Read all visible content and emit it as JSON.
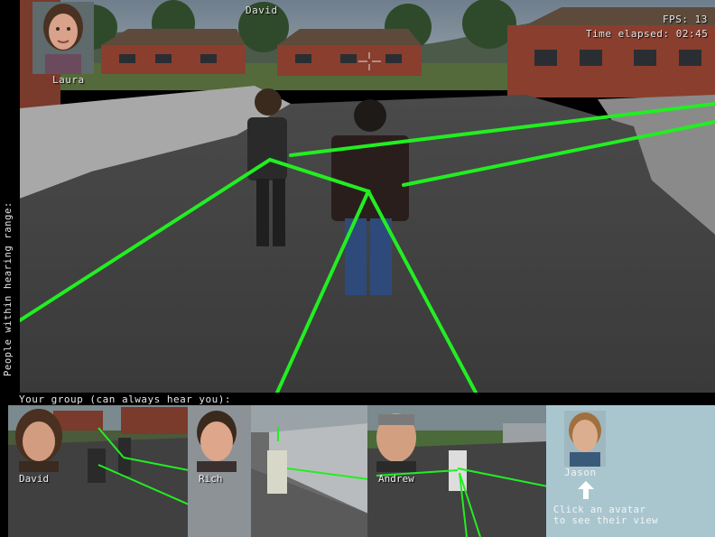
{
  "main_view": {
    "fps_label": "FPS: 13",
    "time_label": "Time elapsed: 02:45",
    "avatar_label": "David"
  },
  "hearing_range": {
    "label": "People within hearing range:",
    "people": [
      {
        "name": "Laura"
      }
    ]
  },
  "group": {
    "label": "Your group (can always hear you):",
    "members": [
      {
        "name": "David"
      },
      {
        "name": "Rich"
      },
      {
        "name": "Andrew"
      }
    ]
  },
  "selector": {
    "name": "Jason",
    "hint_line1": "Click an avatar",
    "hint_line2": "to see their view"
  },
  "colors": {
    "link_line": "#22ee22",
    "panel_bg": "#a9c6cf"
  },
  "icons": {
    "crosshair": "crosshair-icon",
    "arrow": "arrow-up-icon"
  }
}
